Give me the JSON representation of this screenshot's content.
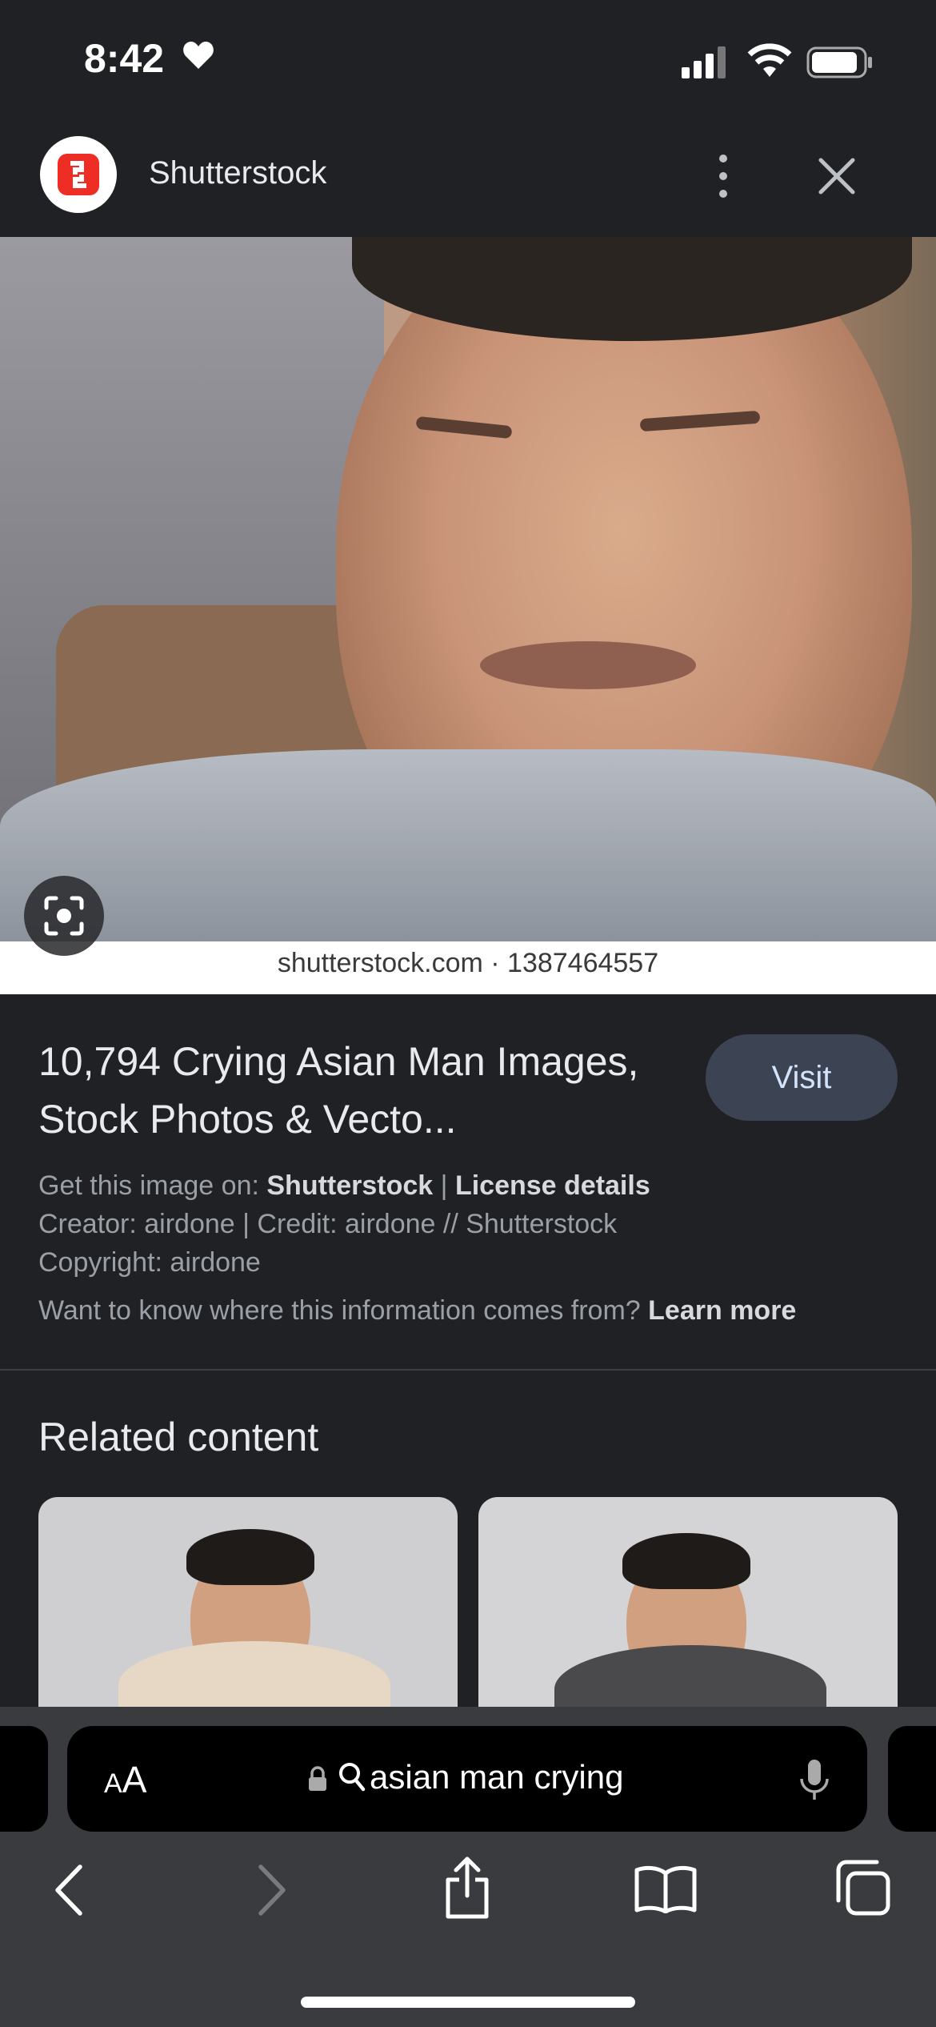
{
  "status_bar": {
    "time": "8:42",
    "icons": [
      "heart-icon",
      "cellular-signal-icon",
      "wifi-icon",
      "battery-icon"
    ]
  },
  "header": {
    "site_name": "Shutterstock",
    "logo_color": "#ee2e24",
    "menu_icon": "more-vertical-icon",
    "close_icon": "close-icon"
  },
  "image": {
    "watermark": "shutterstock.com · 1387464557",
    "lens_icon": "lens-search-icon"
  },
  "result": {
    "title": "10,794 Crying Asian Man Images, Stock Photos & Vecto...",
    "visit_label": "Visit",
    "get_image_prefix": "Get this image on:",
    "source_link": "Shutterstock",
    "separator": "|",
    "license_link": "License details",
    "creator_line": "Creator: airdone | Credit: airdone // Shutterstock",
    "copyright_line": "Copyright: airdone",
    "info_question": "Want to know where this information comes from?",
    "learn_more": "Learn more"
  },
  "related": {
    "title": "Related content"
  },
  "browser": {
    "aa_label_small": "A",
    "aa_label_large": "A",
    "address": "asian man crying",
    "nav": [
      "back-icon",
      "forward-icon",
      "share-icon",
      "bookmarks-icon",
      "tabs-icon"
    ]
  },
  "colors": {
    "background": "#202124",
    "visit_button": "#3c4352",
    "toolbar": "#3a3b3e"
  }
}
